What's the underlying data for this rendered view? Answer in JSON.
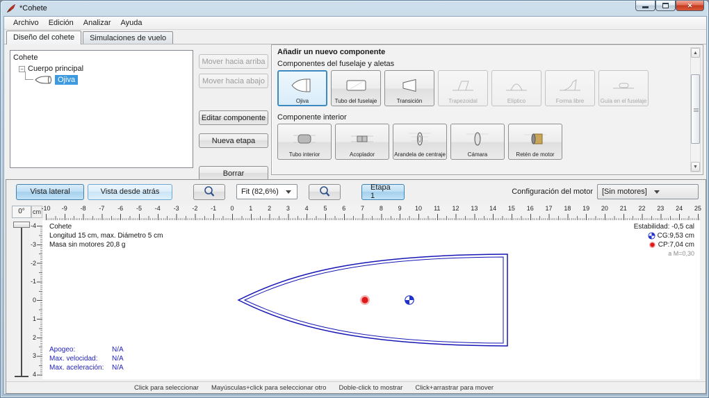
{
  "window": {
    "title": "*Cohete"
  },
  "menu": {
    "items": [
      "Archivo",
      "Edición",
      "Analizar",
      "Ayuda"
    ]
  },
  "tabs": {
    "design": "Diseño del cohete",
    "simulations": "Simulaciones de vuelo"
  },
  "tree": {
    "root": "Cohete",
    "stage": "Cuerpo principal",
    "selected_component": "Ojiva"
  },
  "actions": {
    "move_up": "Mover hacia arriba",
    "move_down": "Mover hacia abajo",
    "edit": "Editar componente",
    "new_stage": "Nueva etapa",
    "delete": "Borrar"
  },
  "add_component": {
    "title": "Añadir un nuevo componente",
    "fuselage_group": "Componentes del fuselaje y aletas",
    "fuselage_items": [
      {
        "label": "Ojiva",
        "state": "selected"
      },
      {
        "label": "Tubo del fuselaje",
        "state": "enabled"
      },
      {
        "label": "Transición",
        "state": "enabled"
      },
      {
        "label": "Trapezoidal",
        "state": "disabled"
      },
      {
        "label": "Elíptico",
        "state": "disabled"
      },
      {
        "label": "Forma libre",
        "state": "disabled"
      },
      {
        "label": "Guía en el fuselaje",
        "state": "disabled"
      }
    ],
    "interior_group": "Componente interior",
    "interior_items": [
      {
        "label": "Tubo interior"
      },
      {
        "label": "Acoplador"
      },
      {
        "label": "Arandela de centraje"
      },
      {
        "label": "Cámara"
      },
      {
        "label": "Retén de motor"
      }
    ]
  },
  "view_toolbar": {
    "side_view": "Vista lateral",
    "back_view": "Vista desde atrás",
    "zoom_value": "Fit (82,6%)",
    "stage_button": "Etapa 1",
    "motor_config_label": "Configuración del motor",
    "motor_config_value": "[Sin motores]"
  },
  "canvas": {
    "rotation": "0°",
    "unit": "cm",
    "h_ruler_labels": [
      "-10",
      "-9",
      "-8",
      "-7",
      "-6",
      "-5",
      "-4",
      "-3",
      "-2",
      "-1",
      "0",
      "1",
      "2",
      "3",
      "4",
      "5",
      "6",
      "7",
      "8",
      "9",
      "10",
      "11",
      "12",
      "13",
      "14",
      "15",
      "16",
      "17",
      "18",
      "19",
      "20",
      "21",
      "22",
      "23",
      "24",
      "25"
    ],
    "v_ruler_labels": [
      "-4",
      "-3",
      "-2",
      "-1",
      "0",
      "1",
      "2",
      "3",
      "4"
    ],
    "info": {
      "name": "Cohete",
      "dimensions": "Longitud 15 cm, max. Diámetro 5 cm",
      "mass": "Masa sin motores 20,8 g"
    },
    "stability": {
      "stability": "Estabilidad: -0,5 cal",
      "cg": "CG:9,53 cm",
      "cp": "CP:7,04 cm",
      "mach": "a M=0,30"
    },
    "flight": {
      "apogee_label": "Apogeo:",
      "apogee_value": "N/A",
      "velocity_label": "Max. velocidad:",
      "velocity_value": "N/A",
      "acceleration_label": "Max. aceleración:",
      "acceleration_value": "N/A"
    },
    "rocket": {
      "cg_cm": 9.53,
      "cp_cm": 7.04,
      "length_cm": 15,
      "diameter_cm": 5
    }
  },
  "status_bar": {
    "hints": [
      "Click para seleccionar",
      "Mayúsculas+click para seleccionar otro",
      "Doble-click to mostrar",
      "Click+arrastrar para mover"
    ]
  },
  "icons": {
    "app": "rocket-icon",
    "minimize": "minimize-icon",
    "maximize": "maximize-icon",
    "close": "close-icon",
    "zoom_in": "magnifier-icon",
    "zoom_out": "magnifier-icon",
    "cg": "cg-marker-icon",
    "cp": "cp-marker-icon"
  },
  "colors": {
    "selection": "#3d9ae1",
    "rocket_outline": "#1515b5",
    "cg_marker": "#2233cc",
    "cp_marker": "#e01818",
    "flight_text": "#2222bb",
    "toggle_border": "#3f81b0"
  }
}
